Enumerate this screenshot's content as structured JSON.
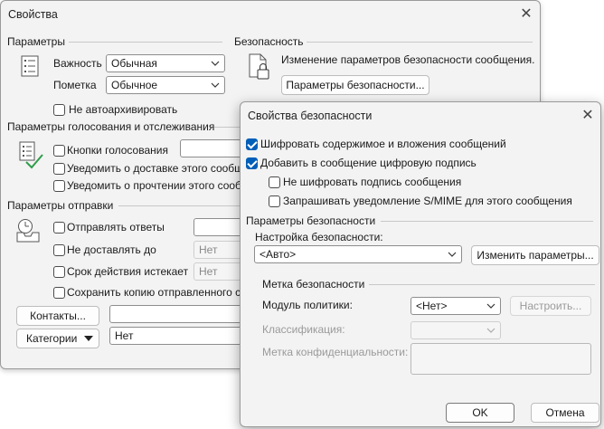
{
  "props": {
    "title": "Свойства",
    "params": {
      "header": "Параметры",
      "importance_label": "Важность",
      "importance_value": "Обычная",
      "sensitivity_label": "Пометка",
      "sensitivity_value": "Обычное",
      "no_autoarchive": "Не автоархивировать"
    },
    "security": {
      "header": "Безопасность",
      "text": "Изменение параметров безопасности сообщения.",
      "button": "Параметры безопасности..."
    },
    "voting": {
      "header": "Параметры голосования и отслеживания",
      "voting_buttons": "Кнопки голосования",
      "delivery_receipt": "Уведомить о доставке этого сообще",
      "read_receipt": "Уведомить о прочтении этого сообще"
    },
    "delivery": {
      "header": "Параметры отправки",
      "reply_to": "Отправлять ответы",
      "do_not_deliver": "Не доставлять до",
      "do_not_deliver_value": "Нет",
      "expires": "Срок действия истекает",
      "expires_value": "Нет",
      "save_copy": "Сохранить копию отправленного с"
    },
    "contacts_button": "Контакты...",
    "categories_button": "Категории",
    "categories_value": "Нет"
  },
  "sec": {
    "title": "Свойства безопасности",
    "encrypt": "Шифровать содержимое и вложения сообщений",
    "add_signature": "Добавить в сообщение цифровую подпись",
    "no_encrypt_signature": "Не шифровать подпись сообщения",
    "request_smime": "Запрашивать уведомление S/MIME для этого сообщения",
    "settings_header": "Параметры безопасности",
    "security_setting_label": "Настройка безопасности:",
    "security_setting_value": "<Авто>",
    "change_settings_button": "Изменить параметры...",
    "label_header": "Метка безопасности",
    "policy_label": "Модуль политики:",
    "policy_value": "<Нет>",
    "configure_button": "Настроить...",
    "classification_label": "Классификация:",
    "privacy_label": "Метка конфиденциальности:",
    "ok": "OK",
    "cancel": "Отмена"
  },
  "colors": {
    "accent": "#005fb8",
    "dialog_bg": "#f3f3f3"
  },
  "checks": {
    "no_autoarchive": false,
    "voting_buttons": false,
    "delivery_receipt": false,
    "read_receipt": false,
    "reply_to": false,
    "do_not_deliver": false,
    "expires": false,
    "save_copy": false,
    "encrypt": true,
    "add_signature": true,
    "no_encrypt_signature": false,
    "request_smime": false
  }
}
